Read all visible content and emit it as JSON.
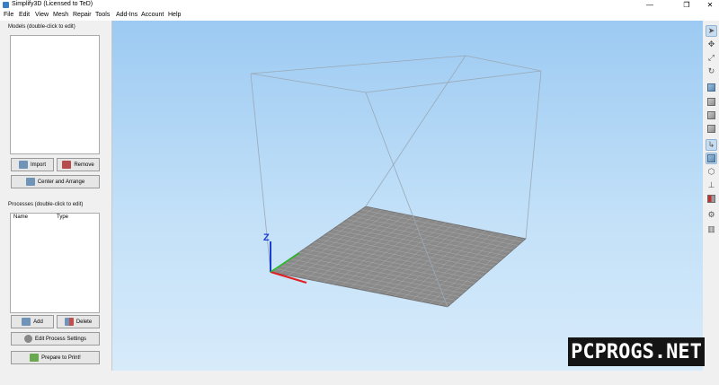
{
  "window": {
    "title": "Simplify3D (Licensed to TeD)",
    "minimize_glyph": "—",
    "maximize_glyph": "❐",
    "close_glyph": "✕"
  },
  "menu": [
    "File",
    "Edit",
    "View",
    "Mesh",
    "Repair",
    "Tools",
    "Add-Ins",
    "Account",
    "Help"
  ],
  "models": {
    "label": "Models (double-click to edit)",
    "import_label": "Import",
    "remove_label": "Remove",
    "center_label": "Center and Arrange"
  },
  "processes": {
    "label": "Processes (double-click to edit)",
    "columns": [
      "Name",
      "Type"
    ],
    "add_label": "Add",
    "delete_label": "Delete",
    "edit_label": "Edit Process Settings",
    "prepare_label": "Prepare to Print!"
  },
  "viewport": {
    "axis_z": "Z",
    "colors": {
      "bed": "#8a8a8a",
      "grid": "#b0b0b0",
      "axis_x": "#e02020",
      "axis_y": "#20c020",
      "axis_z": "#1a3fd0"
    }
  },
  "toolbar_icons": [
    "select-arrow-icon",
    "move-icon",
    "scale-icon",
    "rotate-icon",
    "view-default-icon",
    "view-front-icon",
    "view-side-icon",
    "view-top-icon",
    "axes-toggle-icon",
    "bed-toggle-icon",
    "wireframe-icon",
    "normals-icon",
    "cross-section-icon",
    "settings-gear-icon",
    "supports-icon"
  ],
  "watermark": "PCPROGS.NET"
}
